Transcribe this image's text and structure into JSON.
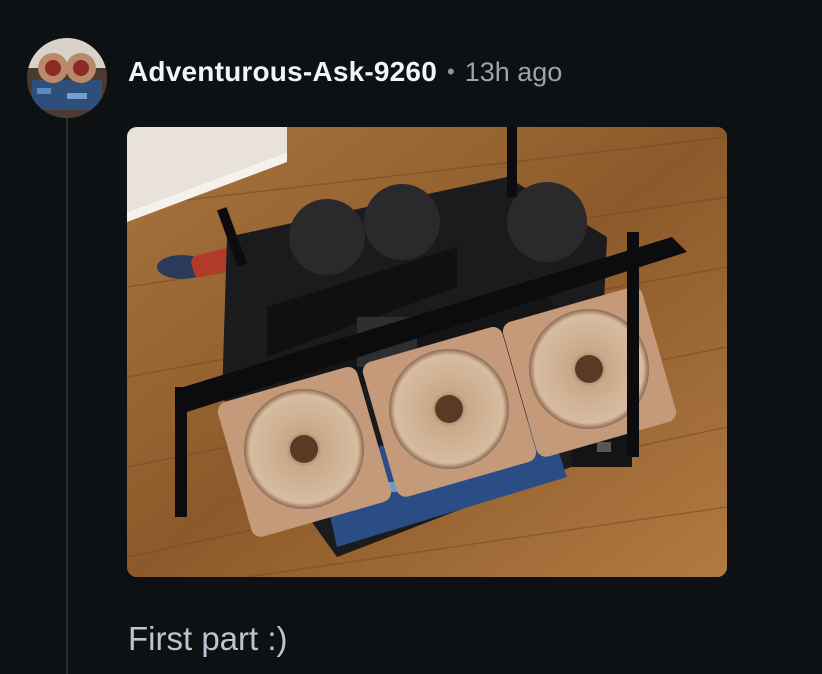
{
  "comment": {
    "author": "Adventurous-Ask-9260",
    "separator": "•",
    "time_ago": "13h ago",
    "body": "First part :)"
  },
  "avatar": {
    "icon": "user-avatar-icon"
  },
  "image": {
    "alt": "Open-frame PC build with three brown and beige fans on wooden floor"
  },
  "colors": {
    "background": "#0e1114",
    "username": "#f2f4f5",
    "meta": "#9aa4ac",
    "body_text": "#b9c6d2",
    "thread_line": "#2b3034"
  }
}
